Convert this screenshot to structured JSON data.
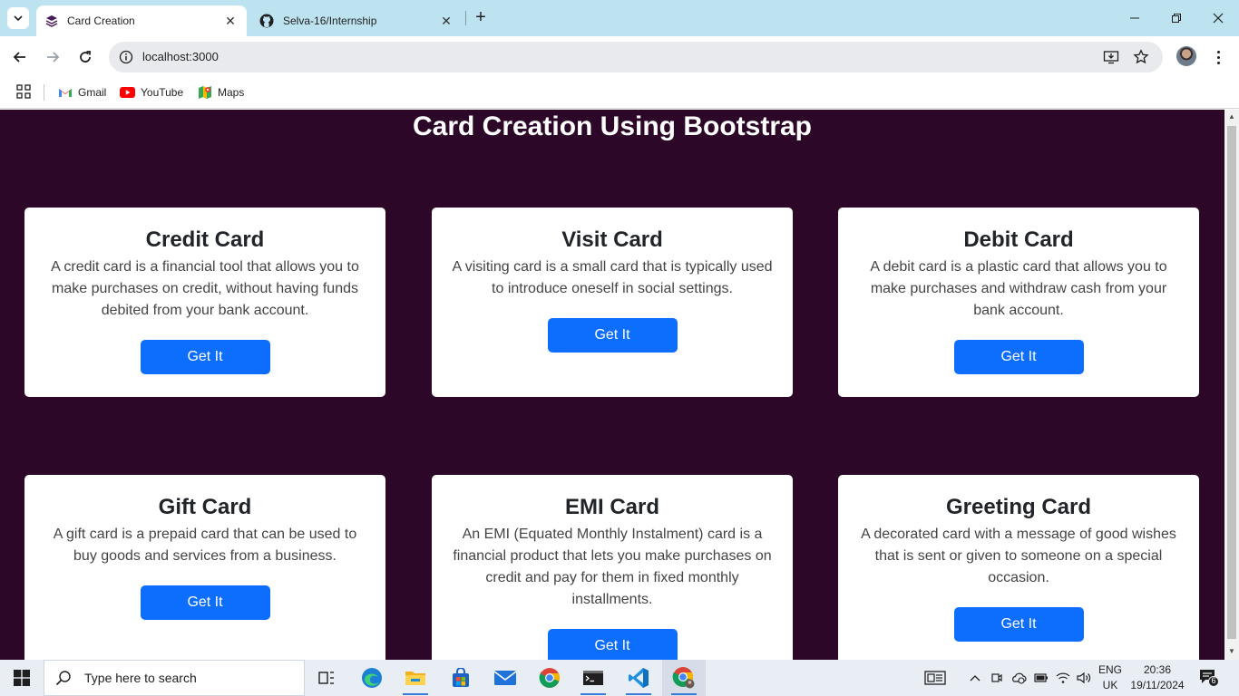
{
  "browser": {
    "tabs": [
      {
        "title": "Card Creation",
        "active": true
      },
      {
        "title": "Selva-16/Internship",
        "active": false
      }
    ],
    "address": "localhost:3000",
    "bookmarks": [
      {
        "label": "Gmail"
      },
      {
        "label": "YouTube"
      },
      {
        "label": "Maps"
      }
    ]
  },
  "page": {
    "title": "Card Creation Using Bootstrap",
    "cards": [
      {
        "title": "Credit Card",
        "text": "A credit card is a financial tool that allows you to make purchases on credit, without having funds debited from your bank account.",
        "button": "Get It"
      },
      {
        "title": "Visit Card",
        "text": "A visiting card is a small card that is typically used to introduce oneself in social settings.",
        "button": "Get It"
      },
      {
        "title": "Debit Card",
        "text": "A debit card is a plastic card that allows you to make purchases and withdraw cash from your bank account.",
        "button": "Get It"
      },
      {
        "title": "Gift Card",
        "text": "A gift card is a prepaid card that can be used to buy goods and services from a business.",
        "button": "Get It"
      },
      {
        "title": "EMI Card",
        "text": "An EMI (Equated Monthly Instalment) card is a financial product that lets you make purchases on credit and pay for them in fixed monthly installments.",
        "button": "Get It"
      },
      {
        "title": "Greeting Card",
        "text": "A decorated card with a message of good wishes that is sent or given to someone on a special occasion.",
        "button": "Get It"
      }
    ]
  },
  "taskbar": {
    "search_placeholder": "Type here to search",
    "language": "ENG",
    "region": "UK",
    "time": "20:36",
    "date": "19/11/2024",
    "notification_count": "6"
  },
  "colors": {
    "page_background": "#2c0727",
    "button_primary": "#0d6efd",
    "tab_strip": "#bde3f0"
  }
}
